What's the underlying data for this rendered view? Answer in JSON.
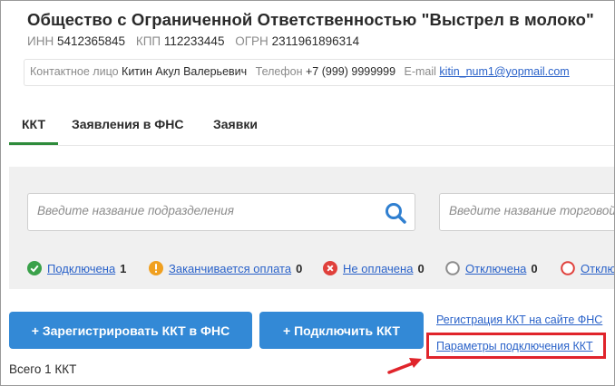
{
  "company": {
    "title": "Общество с Ограниченной Ответственностью \"Выстрел в молоко\"",
    "inn_label": "ИНН",
    "inn": "5412365845",
    "kpp_label": "КПП",
    "kpp": "112233445",
    "ogrn_label": "ОГРН",
    "ogrn": "2311961896314"
  },
  "contact": {
    "person_label": "Контактное лицо",
    "person": "Китин Акул Валерьевич",
    "phone_label": "Телефон",
    "phone": "+7 (999) 9999999",
    "email_label": "E-mail",
    "email": "kitin_num1@yopmail.com"
  },
  "tabs": [
    {
      "label": "ККТ",
      "active": true
    },
    {
      "label": "Заявления в ФНС",
      "active": false
    },
    {
      "label": "Заявки",
      "active": false
    }
  ],
  "filters": {
    "search_placeholder": "Введите название подразделения",
    "search2_placeholder": "Введите название торговой",
    "search_icon": "search-icon"
  },
  "statuses": [
    {
      "label": "Подключена",
      "count": "1",
      "icon": "check-circle-icon",
      "color": "#3aa14a"
    },
    {
      "label": "Заканчивается оплата",
      "count": "0",
      "icon": "warning-circle-icon",
      "color": "#f0a020"
    },
    {
      "label": "Не оплачена",
      "count": "0",
      "icon": "x-circle-icon",
      "color": "#e0403b"
    },
    {
      "label": "Отключена",
      "count": "0",
      "icon": "empty-circle-icon",
      "color": "#8c8c8c"
    },
    {
      "label": "Отклю",
      "count": "",
      "icon": "empty-circle-red-icon",
      "color": "#e0403b"
    }
  ],
  "actions": {
    "register_button": "+ Зарегистрировать ККТ в ФНС",
    "connect_button": "+ Подключить ККТ",
    "fns_register_link": "Регистрация ККТ на сайте ФНС",
    "connection_params_link": "Параметры подключения ККТ"
  },
  "summary": {
    "total": "Всего 1 ККТ"
  },
  "colors": {
    "accent": "#3389d6",
    "tab_underline": "#2e8b3b",
    "link": "#2a62c9",
    "highlight": "#e0242b"
  }
}
